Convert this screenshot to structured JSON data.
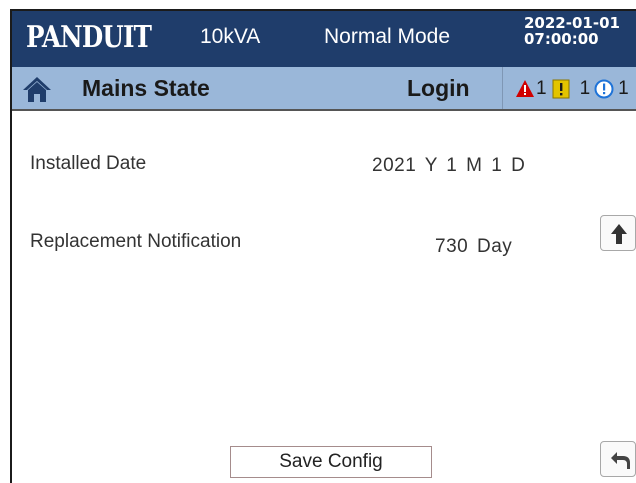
{
  "header": {
    "brand": "PANDUIT",
    "rating": "10kVA",
    "mode": "Normal Mode",
    "date": "2022-01-01",
    "time": "07:00:00"
  },
  "subheader": {
    "title": "Mains State",
    "login_label": "Login",
    "alarms": [
      {
        "icon": "warning-triangle-icon",
        "count": "1",
        "color": "#d10000"
      },
      {
        "icon": "caution-square-icon",
        "count": "",
        "color": "#e2c400"
      },
      {
        "icon": "info-circle-icon",
        "count": "1",
        "color": "#1e73d8"
      },
      {
        "icon": "",
        "count": "1"
      }
    ]
  },
  "fields": [
    {
      "label": "Installed Date",
      "value": "2021 Y 1 M 1 D"
    },
    {
      "label": "Replacement Notification",
      "value": "730 Day"
    }
  ],
  "buttons": {
    "save_label": "Save Config",
    "up_icon": "up-arrow-icon",
    "back_icon": "back-arrow-icon"
  },
  "colors": {
    "topbar": "#1f3d6b",
    "subbar": "#9ab7d9",
    "home_icon": "#1f3d6b"
  }
}
